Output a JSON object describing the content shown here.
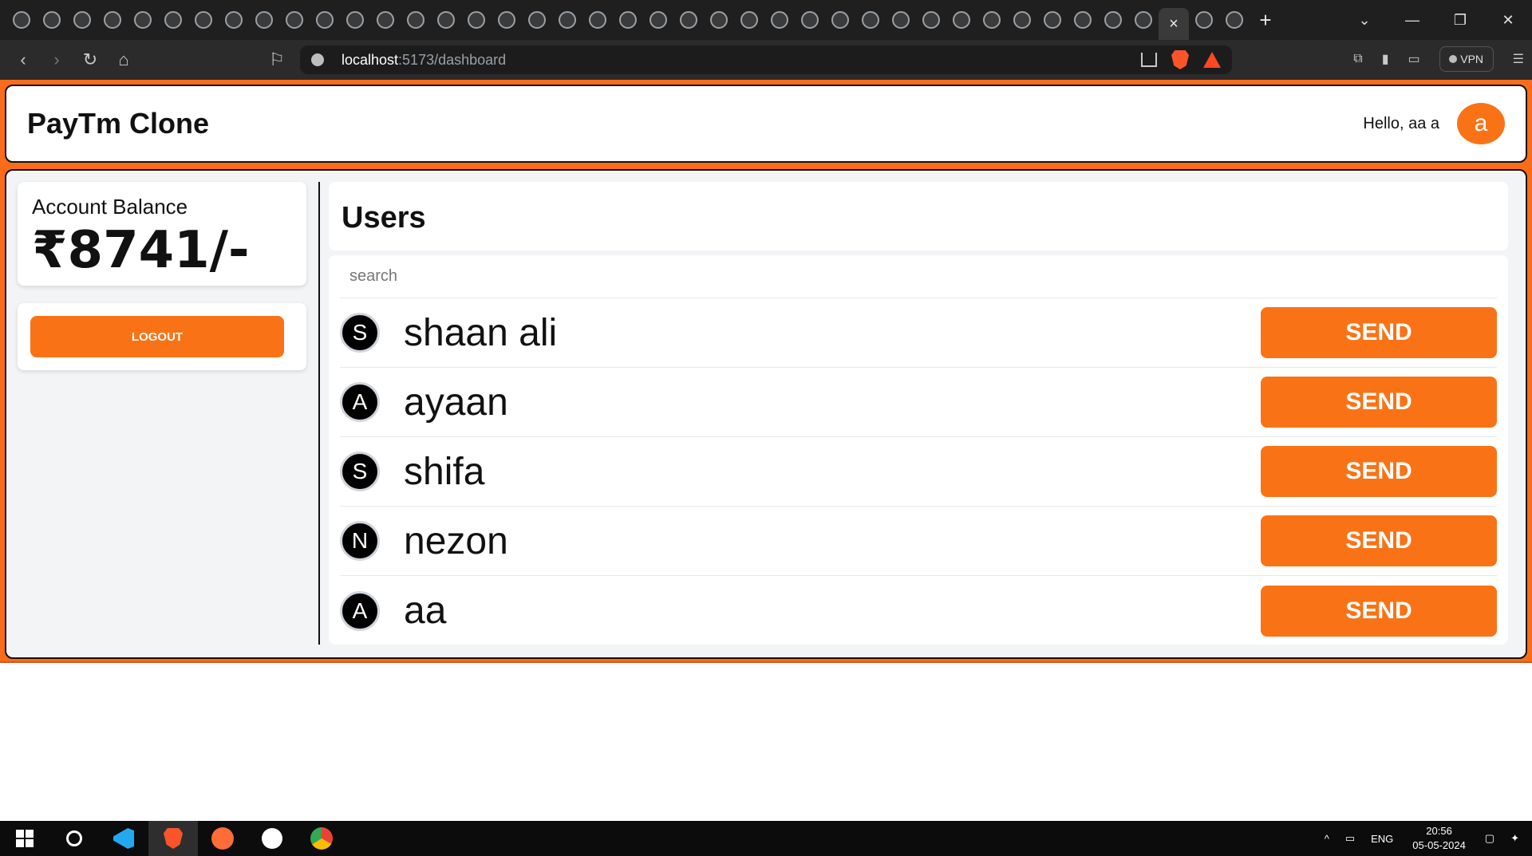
{
  "browser": {
    "url_host": "localhost",
    "url_path": ":5173/dashboard",
    "active_tab_close": "×",
    "new_tab": "+",
    "vpn_label": "VPN",
    "window_controls": [
      "⌄",
      "—",
      "❐",
      "✕"
    ]
  },
  "header": {
    "brand": "PayTm Clone",
    "greeting": "Hello, aa a",
    "avatar_initial": "a"
  },
  "balance": {
    "label": "Account Balance",
    "value": "₹8741/-"
  },
  "logout_label": "LOGOUT",
  "users": {
    "title": "Users",
    "search_placeholder": "search",
    "send_label": "SEND",
    "list": [
      {
        "initial": "S",
        "name": "shaan ali"
      },
      {
        "initial": "A",
        "name": "ayaan"
      },
      {
        "initial": "S",
        "name": "shifa"
      },
      {
        "initial": "N",
        "name": "nezon"
      },
      {
        "initial": "A",
        "name": "aa"
      }
    ]
  },
  "taskbar": {
    "lang": "ENG",
    "time": "20:56",
    "date": "05-05-2024"
  },
  "colors": {
    "accent": "#f97316",
    "band": "#fb6c1a"
  }
}
